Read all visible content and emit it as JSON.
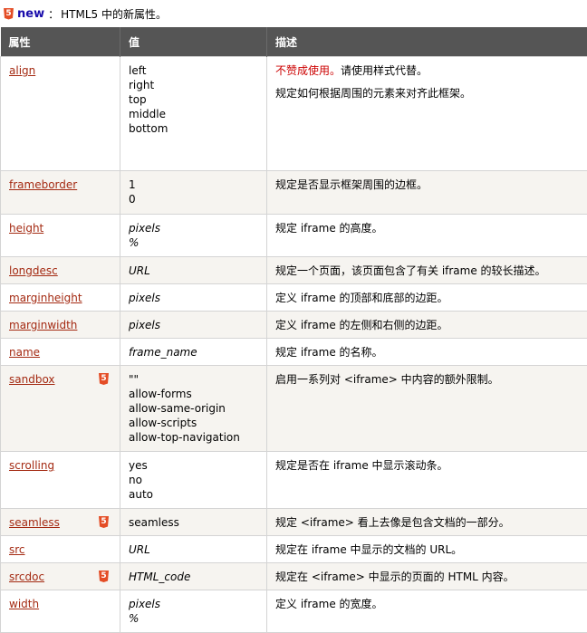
{
  "note": {
    "badge": "5",
    "new": "new",
    "colon": "：",
    "text": "HTML5 中的新属性。"
  },
  "table": {
    "headers": [
      "属性",
      "值",
      "描述"
    ],
    "rows": [
      {
        "name": "align",
        "new": false,
        "values": [
          "left",
          "right",
          "top",
          "middle",
          "bottom"
        ],
        "italic": false,
        "desc_deprecated": "不赞成使用。",
        "desc": [
          "请使用样式代替。",
          "规定如何根据周围的元素来对齐此框架。"
        ]
      },
      {
        "name": "frameborder",
        "new": false,
        "values": [
          "1",
          "0"
        ],
        "italic": false,
        "desc": [
          "规定是否显示框架周围的边框。"
        ]
      },
      {
        "name": "height",
        "new": false,
        "values": [
          "pixels",
          "%"
        ],
        "italic": true,
        "desc": [
          "规定 iframe 的高度。"
        ]
      },
      {
        "name": "longdesc",
        "new": false,
        "values": [
          "URL"
        ],
        "italic": true,
        "desc": [
          "规定一个页面，该页面包含了有关 iframe 的较长描述。"
        ]
      },
      {
        "name": "marginheight",
        "new": false,
        "values": [
          "pixels"
        ],
        "italic": true,
        "desc": [
          "定义 iframe 的顶部和底部的边距。"
        ]
      },
      {
        "name": "marginwidth",
        "new": false,
        "values": [
          "pixels"
        ],
        "italic": true,
        "desc": [
          "定义 iframe 的左侧和右侧的边距。"
        ]
      },
      {
        "name": "name",
        "new": false,
        "values": [
          "frame_name"
        ],
        "italic": true,
        "desc": [
          "规定 iframe 的名称。"
        ]
      },
      {
        "name": "sandbox",
        "new": true,
        "values": [
          "\"\"",
          "allow-forms",
          "allow-same-origin",
          "allow-scripts",
          "allow-top-navigation"
        ],
        "italic": false,
        "desc": [
          "启用一系列对 <iframe> 中内容的额外限制。"
        ]
      },
      {
        "name": "scrolling",
        "new": false,
        "values": [
          "yes",
          "no",
          "auto"
        ],
        "italic": false,
        "desc": [
          "规定是否在 iframe 中显示滚动条。"
        ]
      },
      {
        "name": "seamless",
        "new": true,
        "values": [
          "seamless"
        ],
        "italic": false,
        "desc": [
          "规定 <iframe> 看上去像是包含文档的一部分。"
        ]
      },
      {
        "name": "src",
        "new": false,
        "values": [
          "URL"
        ],
        "italic": true,
        "desc": [
          "规定在 iframe 中显示的文档的 URL。"
        ]
      },
      {
        "name": "srcdoc",
        "new": true,
        "values": [
          "HTML_code"
        ],
        "italic": true,
        "desc": [
          "规定在 <iframe> 中显示的页面的 HTML 内容。"
        ]
      },
      {
        "name": "width",
        "new": false,
        "values": [
          "pixels",
          "%"
        ],
        "italic": true,
        "desc": [
          "定义 iframe 的宽度。"
        ]
      }
    ]
  }
}
